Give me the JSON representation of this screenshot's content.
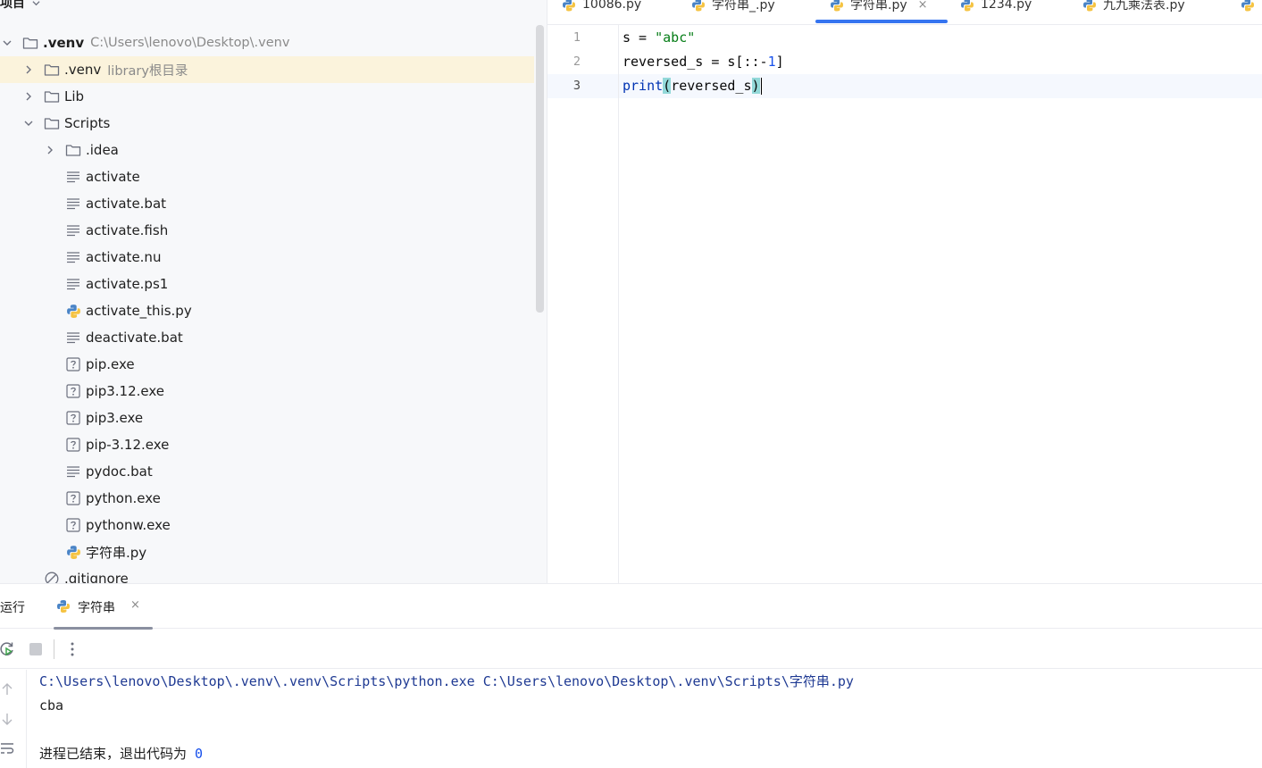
{
  "project": {
    "title": "项目",
    "tree": [
      {
        "name": ".venv",
        "hint": "C:\\Users\\lenovo\\Desktop\\.venv",
        "depth": 0,
        "kind": "folder",
        "arrow": "down",
        "bold": true
      },
      {
        "name": ".venv",
        "hint": "library根目录",
        "depth": 1,
        "kind": "folder",
        "arrow": "right",
        "highlight": true
      },
      {
        "name": "Lib",
        "hint": "",
        "depth": 1,
        "kind": "folder",
        "arrow": "right"
      },
      {
        "name": "Scripts",
        "hint": "",
        "depth": 1,
        "kind": "folder",
        "arrow": "down"
      },
      {
        "name": ".idea",
        "hint": "",
        "depth": 2,
        "kind": "folder",
        "arrow": "right"
      },
      {
        "name": "activate",
        "hint": "",
        "depth": 2,
        "kind": "text"
      },
      {
        "name": "activate.bat",
        "hint": "",
        "depth": 2,
        "kind": "text"
      },
      {
        "name": "activate.fish",
        "hint": "",
        "depth": 2,
        "kind": "text"
      },
      {
        "name": "activate.nu",
        "hint": "",
        "depth": 2,
        "kind": "text"
      },
      {
        "name": "activate.ps1",
        "hint": "",
        "depth": 2,
        "kind": "text"
      },
      {
        "name": "activate_this.py",
        "hint": "",
        "depth": 2,
        "kind": "python"
      },
      {
        "name": "deactivate.bat",
        "hint": "",
        "depth": 2,
        "kind": "text"
      },
      {
        "name": "pip.exe",
        "hint": "",
        "depth": 2,
        "kind": "unknown"
      },
      {
        "name": "pip3.12.exe",
        "hint": "",
        "depth": 2,
        "kind": "unknown"
      },
      {
        "name": "pip3.exe",
        "hint": "",
        "depth": 2,
        "kind": "unknown"
      },
      {
        "name": "pip-3.12.exe",
        "hint": "",
        "depth": 2,
        "kind": "unknown"
      },
      {
        "name": "pydoc.bat",
        "hint": "",
        "depth": 2,
        "kind": "text"
      },
      {
        "name": "python.exe",
        "hint": "",
        "depth": 2,
        "kind": "unknown"
      },
      {
        "name": "pythonw.exe",
        "hint": "",
        "depth": 2,
        "kind": "unknown"
      },
      {
        "name": "字符串.py",
        "hint": "",
        "depth": 2,
        "kind": "python"
      },
      {
        "name": ".gitignore",
        "hint": "",
        "depth": 1,
        "kind": "ignored"
      }
    ]
  },
  "editor": {
    "tabs": [
      {
        "label": "10086.py",
        "active": false
      },
      {
        "label": "字符串_.py",
        "active": false
      },
      {
        "label": "字符串.py",
        "active": true,
        "close": "×"
      },
      {
        "label": "1234.py",
        "active": false
      },
      {
        "label": "九九乘法表.py",
        "active": false
      }
    ],
    "line_numbers": [
      "1",
      "2",
      "3"
    ],
    "code": {
      "l1": {
        "var": "s = ",
        "str": "\"abc\""
      },
      "l2": {
        "pre": "reversed_s = s[::-",
        "num": "1",
        "post": "]"
      },
      "l3": {
        "kw": "print",
        "open": "(",
        "arg": "reversed_s",
        "close": ")"
      }
    }
  },
  "run": {
    "title": "运行",
    "tab_label": "字符串",
    "tab_close": "×",
    "console": {
      "command": "C:\\Users\\lenovo\\Desktop\\.venv\\.venv\\Scripts\\python.exe C:\\Users\\lenovo\\Desktop\\.venv\\Scripts\\字符串.py",
      "output": "cba",
      "exit_message": "进程已结束，退出代码为 ",
      "exit_code": "0"
    }
  },
  "colors": {
    "accent": "#3574f0",
    "highlight_row": "#fbf3dc",
    "string": "#067d17",
    "number": "#1750eb",
    "keyword": "#0033b3"
  }
}
